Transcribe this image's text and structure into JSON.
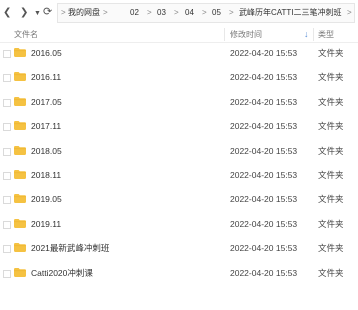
{
  "toolbar": {
    "back_icon": "back-arrow-icon",
    "forward_icon": "forward-arrow-icon",
    "dropdown_icon": "chevron-down-icon",
    "refresh_icon": "refresh-icon"
  },
  "breadcrumb": [
    "我的网盘",
    "02",
    "03",
    "04",
    "05",
    "武峰历年CATTI二三笔冲刺班"
  ],
  "columns": {
    "name": "文件名",
    "modified": "修改时间",
    "type": "类型"
  },
  "sort": {
    "column": "modified",
    "direction": "descending"
  },
  "files": [
    {
      "name": "2016.05",
      "modified": "2022-04-20 15:53",
      "type": "文件夹"
    },
    {
      "name": "2016.11",
      "modified": "2022-04-20 15:53",
      "type": "文件夹"
    },
    {
      "name": "2017.05",
      "modified": "2022-04-20 15:53",
      "type": "文件夹"
    },
    {
      "name": "2017.11",
      "modified": "2022-04-20 15:53",
      "type": "文件夹"
    },
    {
      "name": "2018.05",
      "modified": "2022-04-20 15:53",
      "type": "文件夹"
    },
    {
      "name": "2018.11",
      "modified": "2022-04-20 15:53",
      "type": "文件夹"
    },
    {
      "name": "2019.05",
      "modified": "2022-04-20 15:53",
      "type": "文件夹"
    },
    {
      "name": "2019.11",
      "modified": "2022-04-20 15:53",
      "type": "文件夹"
    },
    {
      "name": "2021最新武峰冲刺班",
      "modified": "2022-04-20 15:53",
      "type": "文件夹"
    },
    {
      "name": "Catti2020冲刺课",
      "modified": "2022-04-20 15:53",
      "type": "文件夹"
    }
  ],
  "colors": {
    "folder": "#f5c242",
    "folder_tab": "#e8ad1f",
    "sort_accent": "#5b8fd6"
  }
}
